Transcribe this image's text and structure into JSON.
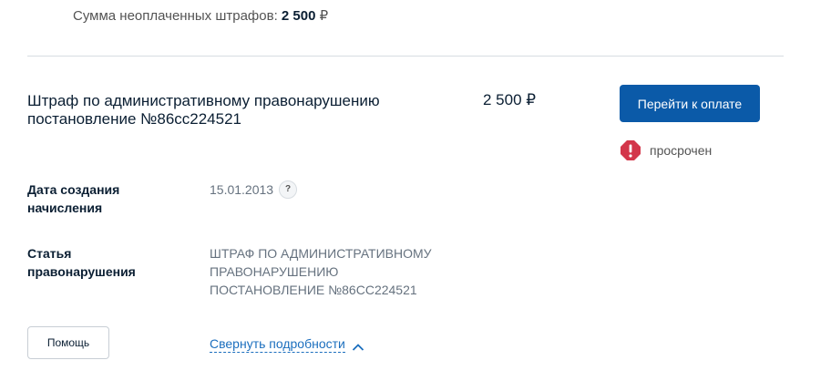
{
  "summary": {
    "label": "Сумма неоплаченных штрафов:",
    "amount": "2 500",
    "currency": "₽"
  },
  "fine": {
    "title_line1": "Штраф по административному правонарушению",
    "title_line2": "постановление №86сс224521",
    "amount": "2 500 ₽",
    "pay_button": "Перейти к оплате",
    "status": "просрочен",
    "status_color": "#d3364a",
    "accent_color": "#0b5aa8"
  },
  "details": {
    "date_label_line1": "Дата создания",
    "date_label_line2": "начисления",
    "date_value": "15.01.2013",
    "date_help": "?",
    "article_label_line1": "Статья",
    "article_label_line2": "правонарушения",
    "article_line1": "ШТРАФ ПО АДМИНИСТРАТИВНОМУ",
    "article_line2": "ПРАВОНАРУШЕНИЮ",
    "article_line3": "ПОСТАНОВЛЕНИЕ №86СС224521"
  },
  "actions": {
    "help_button": "Помощь",
    "collapse_link": "Свернуть подробности"
  },
  "icons": {
    "status": "exclamation-octagon-icon",
    "help": "question-icon",
    "collapse": "chevron-up-icon"
  }
}
